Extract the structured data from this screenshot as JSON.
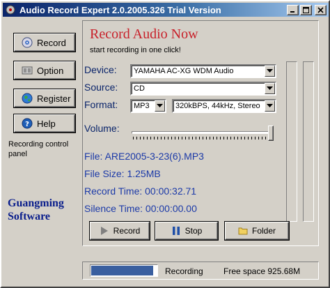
{
  "window": {
    "title": "Audio Record Expert 2.0.2005.326 Trial Version"
  },
  "sidebar": {
    "buttons": [
      {
        "label": "Record",
        "icon": "record-disc-icon"
      },
      {
        "label": "Option",
        "icon": "option-icon"
      },
      {
        "label": "Register",
        "icon": "globe-icon"
      },
      {
        "label": "Help",
        "icon": "help-icon"
      }
    ],
    "panel_note": "Recording control panel",
    "brand_line1": "Guangming",
    "brand_line2": "Software"
  },
  "main": {
    "heading": "Record Audio Now",
    "subheading": "start recording in one click!",
    "device_label": "Device:",
    "device_value": "YAMAHA AC-XG WDM Audio",
    "source_label": "Source:",
    "source_value": "CD",
    "format_label": "Format:",
    "format_value": "MP3",
    "quality_value": "320kBPS, 44kHz, Stereo",
    "volume_label": "Volume:",
    "volume_level": 1.0,
    "file_line": "File: ARE2005-3-23(6).MP3",
    "size_line": "File Size: 1.25MB",
    "record_time_line": "Record Time: 00:00:32.71",
    "silence_time_line": "Silence Time: 00:00:00.00",
    "record_button": "Record",
    "stop_button": "Stop",
    "folder_button": "Folder"
  },
  "status": {
    "progress": 0.95,
    "state": "Recording",
    "free_space": "Free space 925.68M"
  },
  "colors": {
    "accent_title": "#0a246a",
    "heading_red": "#c8202a",
    "label_blue": "#0a246a",
    "info_blue": "#1c3aa8",
    "brand_blue": "#0a1e8c"
  }
}
